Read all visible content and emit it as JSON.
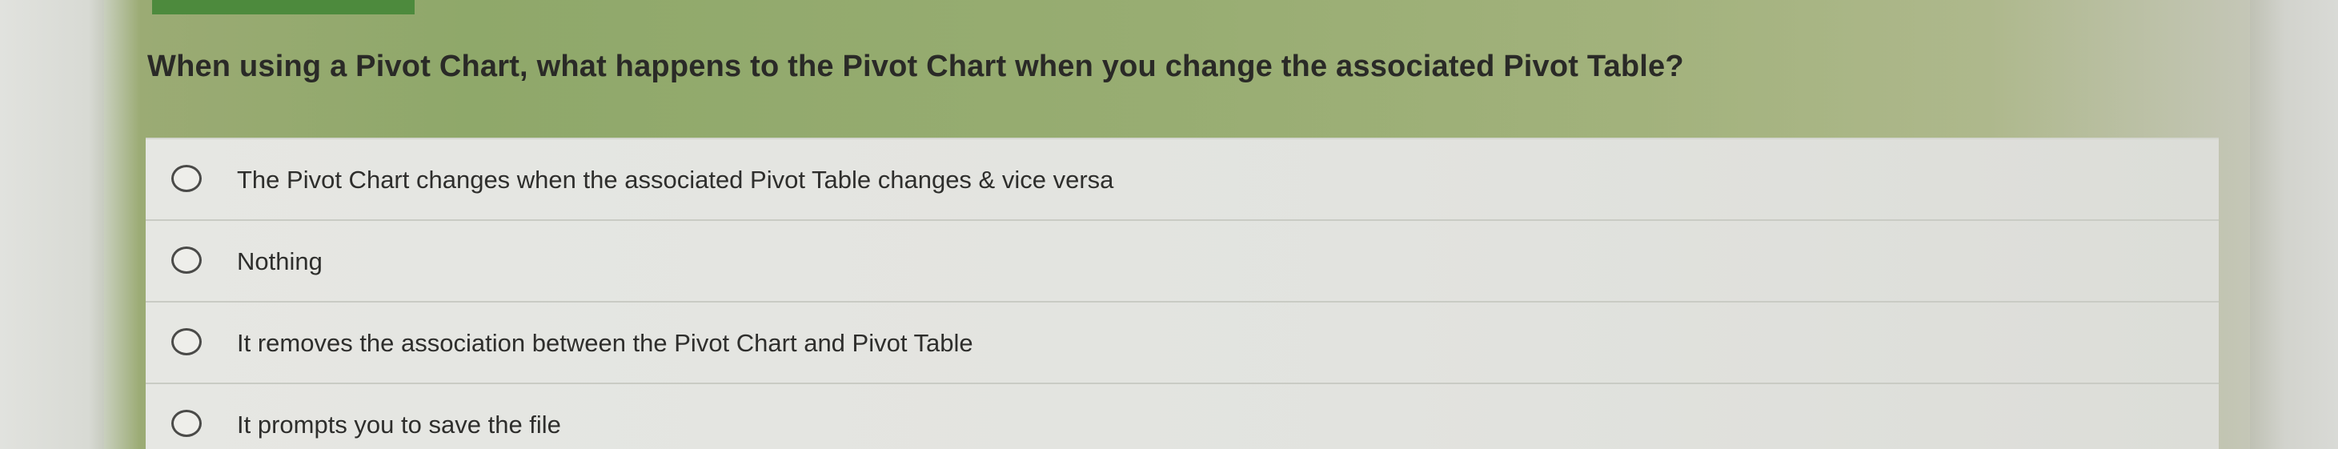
{
  "question": {
    "text": "When using a Pivot Chart, what happens to the Pivot Chart when you change the associated Pivot Table?"
  },
  "options": [
    {
      "label": "The Pivot Chart changes when the associated Pivot Table changes & vice versa",
      "selected": false
    },
    {
      "label": "Nothing",
      "selected": false
    },
    {
      "label": "It removes the association between the Pivot Chart and Pivot Table",
      "selected": false
    },
    {
      "label": "It prompts you to save the file",
      "selected": false
    }
  ],
  "colors": {
    "header_tab": "#4d8a3d",
    "background": "#98ad72"
  }
}
